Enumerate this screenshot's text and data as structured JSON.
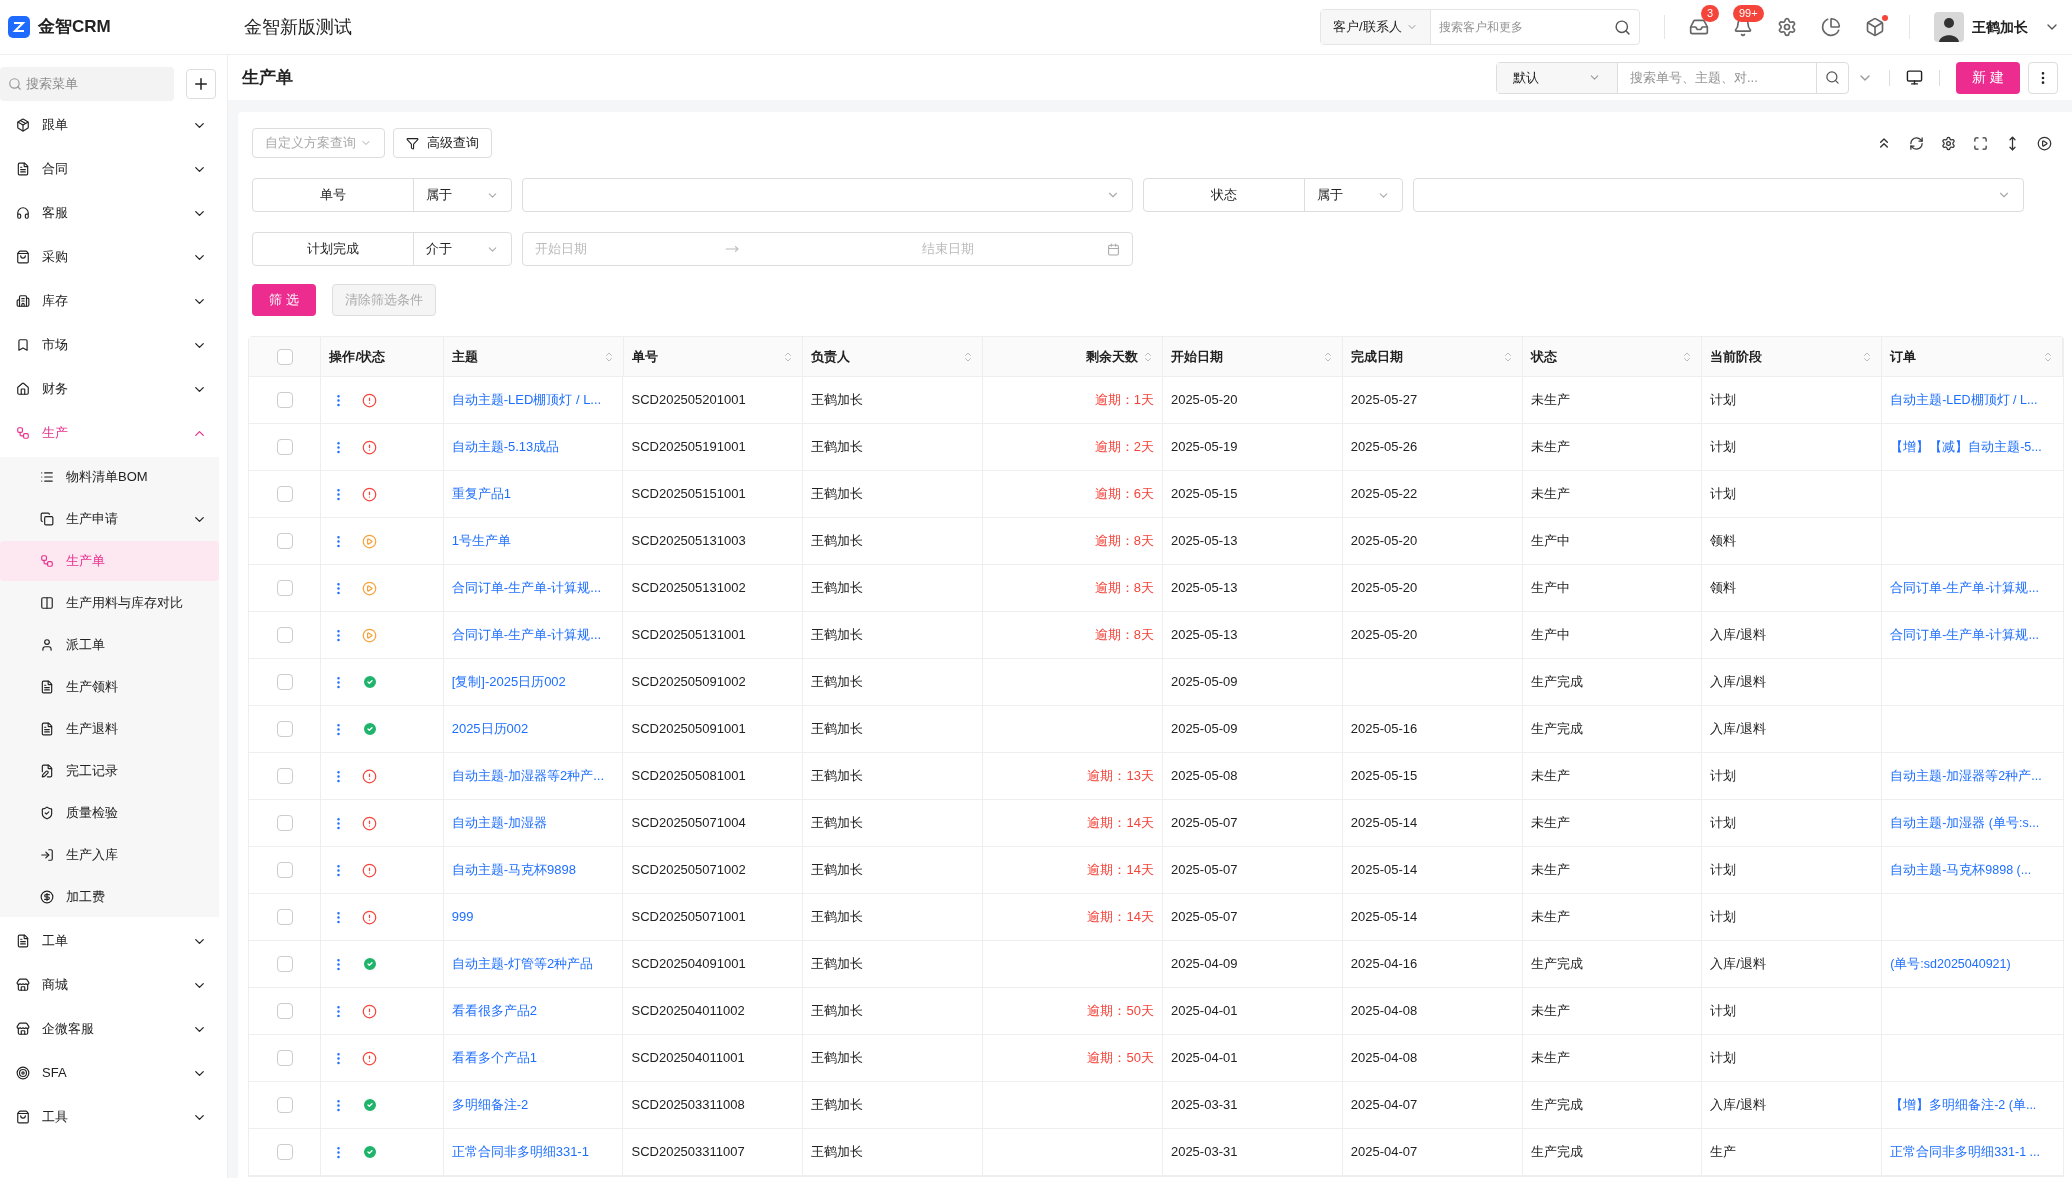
{
  "app": {
    "logo": "金智CRM",
    "title": "金智新版测试"
  },
  "topbar": {
    "scope": "客户/联系人",
    "search_placeholder": "搜索客户和更多",
    "inbox_badge": "3",
    "bell_badge": "99+",
    "user": "王鹤加长"
  },
  "sidebar": {
    "search_placeholder": "搜索菜单",
    "items": [
      {
        "label": "跟单",
        "expanded": false,
        "selected": false
      },
      {
        "label": "合同",
        "expanded": false,
        "selected": false
      },
      {
        "label": "客服",
        "expanded": false,
        "selected": false
      },
      {
        "label": "采购",
        "expanded": false,
        "selected": false
      },
      {
        "label": "库存",
        "expanded": false,
        "selected": false
      },
      {
        "label": "市场",
        "expanded": false,
        "selected": false
      },
      {
        "label": "财务",
        "expanded": false,
        "selected": false
      },
      {
        "label": "生产",
        "expanded": true,
        "selected": true,
        "children": [
          {
            "label": "物料清单BOM",
            "selected": false,
            "has_children": false
          },
          {
            "label": "生产申请",
            "selected": false,
            "has_children": true
          },
          {
            "label": "生产单",
            "selected": true,
            "has_children": false
          },
          {
            "label": "生产用料与库存对比",
            "selected": false,
            "has_children": false
          },
          {
            "label": "派工单",
            "selected": false,
            "has_children": false
          },
          {
            "label": "生产领料",
            "selected": false,
            "has_children": false
          },
          {
            "label": "生产退料",
            "selected": false,
            "has_children": false
          },
          {
            "label": "完工记录",
            "selected": false,
            "has_children": false
          },
          {
            "label": "质量检验",
            "selected": false,
            "has_children": false
          },
          {
            "label": "生产入库",
            "selected": false,
            "has_children": false
          },
          {
            "label": "加工费",
            "selected": false,
            "has_children": false
          }
        ]
      },
      {
        "label": "工单",
        "expanded": false,
        "selected": false
      },
      {
        "label": "商城",
        "expanded": false,
        "selected": false
      },
      {
        "label": "企微客服",
        "expanded": false,
        "selected": false
      },
      {
        "label": "SFA",
        "expanded": false,
        "selected": false
      },
      {
        "label": "工具",
        "expanded": false,
        "selected": false
      }
    ]
  },
  "page": {
    "title": "生产单",
    "view": "默认",
    "search_placeholder": "搜索单号、主题、对...",
    "new_button": "新 建"
  },
  "filters": {
    "custom_query": "自定义方案查询",
    "advanced": "高级查询",
    "rows": [
      [
        {
          "field": "单号",
          "op": "属于",
          "kind": "select"
        },
        {
          "field": "状态",
          "op": "属于",
          "kind": "select"
        }
      ],
      [
        {
          "field": "计划完成",
          "op": "介于",
          "kind": "daterange",
          "start_placeholder": "开始日期",
          "end_placeholder": "结束日期"
        }
      ]
    ],
    "apply": "筛 选",
    "clear": "清除筛选条件"
  },
  "table": {
    "all_checked": false,
    "columns": [
      "操作/状态",
      "主题",
      "单号",
      "负责人",
      "剩余天数",
      "开始日期",
      "完成日期",
      "状态",
      "当前阶段",
      "订单"
    ],
    "rows": [
      {
        "checked": false,
        "kind": "alert",
        "subject": "自动主题-LED棚顶灯 / L...",
        "number": "SCD202505201001",
        "owner": "王鹤加长",
        "remaining": "逾期：1天",
        "start": "2025-05-20",
        "end": "2025-05-27",
        "status": "未生产",
        "stage": "计划",
        "order": "自动主题-LED棚顶灯 / L..."
      },
      {
        "checked": false,
        "kind": "alert",
        "subject": "自动主题-5.13成品",
        "number": "SCD202505191001",
        "owner": "王鹤加长",
        "remaining": "逾期：2天",
        "start": "2025-05-19",
        "end": "2025-05-26",
        "status": "未生产",
        "stage": "计划",
        "order": "【增】【减】自动主题-5..."
      },
      {
        "checked": false,
        "kind": "alert",
        "subject": "重复产品1",
        "number": "SCD202505151001",
        "owner": "王鹤加长",
        "remaining": "逾期：6天",
        "start": "2025-05-15",
        "end": "2025-05-22",
        "status": "未生产",
        "stage": "计划"
      },
      {
        "checked": false,
        "kind": "progress",
        "subject": "1号生产单",
        "number": "SCD202505131003",
        "owner": "王鹤加长",
        "remaining": "逾期：8天",
        "start": "2025-05-13",
        "end": "2025-05-20",
        "status": "生产中",
        "stage": "领料"
      },
      {
        "checked": false,
        "kind": "progress",
        "subject": "合同订单-生产单-计算规...",
        "number": "SCD202505131002",
        "owner": "王鹤加长",
        "remaining": "逾期：8天",
        "start": "2025-05-13",
        "end": "2025-05-20",
        "status": "生产中",
        "stage": "领料",
        "order": "合同订单-生产单-计算规..."
      },
      {
        "checked": false,
        "kind": "progress",
        "subject": "合同订单-生产单-计算规...",
        "number": "SCD202505131001",
        "owner": "王鹤加长",
        "remaining": "逾期：8天",
        "start": "2025-05-13",
        "end": "2025-05-20",
        "status": "生产中",
        "stage": "入库/退料",
        "order": "合同订单-生产单-计算规..."
      },
      {
        "checked": false,
        "kind": "done",
        "subject": "[复制]-2025日历002",
        "number": "SCD202505091002",
        "owner": "王鹤加长",
        "start": "2025-05-09",
        "status": "生产完成",
        "stage": "入库/退料"
      },
      {
        "checked": false,
        "kind": "done",
        "subject": "2025日历002",
        "number": "SCD202505091001",
        "owner": "王鹤加长",
        "start": "2025-05-09",
        "end": "2025-05-16",
        "status": "生产完成",
        "stage": "入库/退料"
      },
      {
        "checked": false,
        "kind": "alert",
        "subject": "自动主题-加湿器等2种产...",
        "number": "SCD202505081001",
        "owner": "王鹤加长",
        "remaining": "逾期：13天",
        "start": "2025-05-08",
        "end": "2025-05-15",
        "status": "未生产",
        "stage": "计划",
        "order": "自动主题-加湿器等2种产..."
      },
      {
        "checked": false,
        "kind": "alert",
        "subject": "自动主题-加湿器",
        "number": "SCD202505071004",
        "owner": "王鹤加长",
        "remaining": "逾期：14天",
        "start": "2025-05-07",
        "end": "2025-05-14",
        "status": "未生产",
        "stage": "计划",
        "order": "自动主题-加湿器 (单号:s..."
      },
      {
        "checked": false,
        "kind": "alert",
        "subject": "自动主题-马克杯9898",
        "number": "SCD202505071002",
        "owner": "王鹤加长",
        "remaining": "逾期：14天",
        "start": "2025-05-07",
        "end": "2025-05-14",
        "status": "未生产",
        "stage": "计划",
        "order": "自动主题-马克杯9898 (..."
      },
      {
        "checked": false,
        "kind": "alert",
        "subject": "999",
        "number": "SCD202505071001",
        "owner": "王鹤加长",
        "remaining": "逾期：14天",
        "start": "2025-05-07",
        "end": "2025-05-14",
        "status": "未生产",
        "stage": "计划"
      },
      {
        "checked": false,
        "kind": "done",
        "subject": "自动主题-灯管等2种产品",
        "number": "SCD202504091001",
        "owner": "王鹤加长",
        "start": "2025-04-09",
        "end": "2025-04-16",
        "status": "生产完成",
        "stage": "入库/退料",
        "order": "(单号:sd2025040921)"
      },
      {
        "checked": false,
        "kind": "alert",
        "subject": "看看很多产品2",
        "number": "SCD202504011002",
        "owner": "王鹤加长",
        "remaining": "逾期：50天",
        "start": "2025-04-01",
        "end": "2025-04-08",
        "status": "未生产",
        "stage": "计划"
      },
      {
        "checked": false,
        "kind": "alert",
        "subject": "看看多个产品1",
        "number": "SCD202504011001",
        "owner": "王鹤加长",
        "remaining": "逾期：50天",
        "start": "2025-04-01",
        "end": "2025-04-08",
        "status": "未生产",
        "stage": "计划"
      },
      {
        "checked": false,
        "kind": "done",
        "subject": "多明细备注-2",
        "number": "SCD202503311008",
        "owner": "王鹤加长",
        "start": "2025-03-31",
        "end": "2025-04-07",
        "status": "生产完成",
        "stage": "入库/退料",
        "order": "【增】多明细备注-2 (单..."
      },
      {
        "checked": false,
        "kind": "done",
        "subject": "正常合同非多明细331-1",
        "number": "SCD202503311007",
        "owner": "王鹤加长",
        "start": "2025-03-31",
        "end": "2025-04-07",
        "status": "生产完成",
        "stage": "生产",
        "order": "正常合同非多明细331-1 ..."
      }
    ]
  }
}
